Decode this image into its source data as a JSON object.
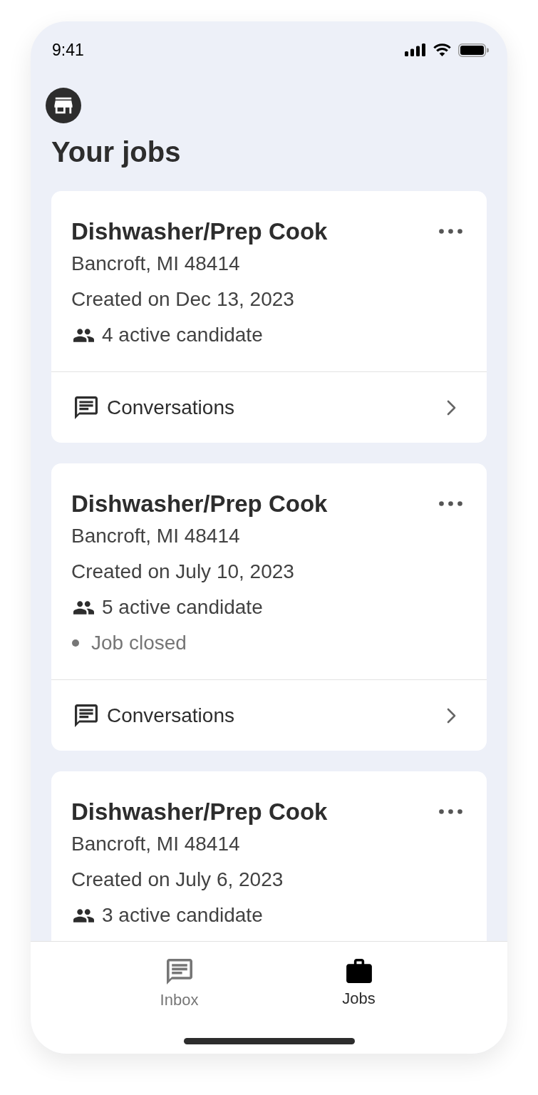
{
  "status_bar": {
    "time": "9:41"
  },
  "header": {
    "title": "Your jobs"
  },
  "jobs": [
    {
      "title": "Dishwasher/Prep Cook",
      "location": "Bancroft, MI 48414",
      "created": "Created on Dec 13, 2023",
      "candidates": "4 active candidate",
      "link": "Conversations"
    },
    {
      "title": "Dishwasher/Prep Cook",
      "location": "Bancroft, MI 48414",
      "created": "Created on July 10, 2023",
      "candidates": "5 active candidate",
      "status": "Job closed",
      "link": "Conversations"
    },
    {
      "title": "Dishwasher/Prep Cook",
      "location": "Bancroft, MI 48414",
      "created": "Created on July 6, 2023",
      "candidates": "3 active candidate"
    }
  ],
  "tab_bar": [
    {
      "label": "Inbox",
      "selected": false
    },
    {
      "label": "Jobs",
      "selected": true
    }
  ]
}
